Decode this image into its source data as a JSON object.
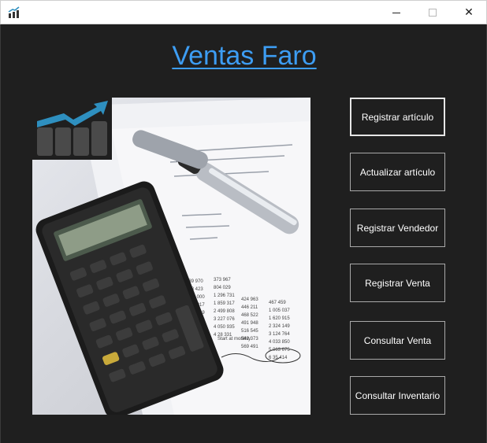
{
  "window": {
    "icon": "chart-app-icon",
    "minimize_label": "minimize",
    "maximize_label": "maximize",
    "close_glyph": "✕"
  },
  "page": {
    "title": "Ventas Faro"
  },
  "image": {
    "description_icon": "calculator-finance-image",
    "logo_icon": "growth-chart-logo-icon"
  },
  "buttons": [
    {
      "label": "Registrar artículo"
    },
    {
      "label": "Actualizar artículo"
    },
    {
      "label": "Registrar Vendedor"
    },
    {
      "label": "Registrar Venta"
    },
    {
      "label": "Consultar Venta"
    },
    {
      "label": "Consultar Inventario"
    }
  ],
  "colors": {
    "background": "#1f1f1f",
    "title": "#3d9df3",
    "button_border": "#a9a9a9",
    "button_text": "#ffffff",
    "logo_arrow": "#2e8fbf",
    "logo_bars": "#4a4a4a"
  }
}
